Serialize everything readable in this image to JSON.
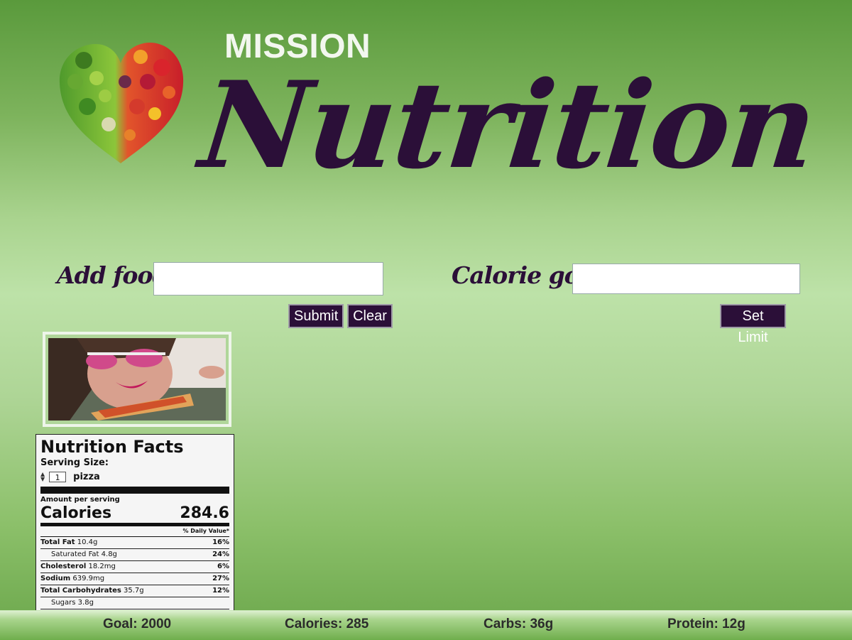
{
  "header": {
    "mission": "MISSION",
    "brand": "Nutrition"
  },
  "form": {
    "add_food_label": "Add food:",
    "food_input_value": "",
    "calorie_goal_label": "Calorie goal:",
    "goal_input_value": "",
    "submit_label": "Submit",
    "clear_label": "Clear",
    "set_limit_label": "Set Limit"
  },
  "nutrition_facts": {
    "title": "Nutrition Facts",
    "serving_size_label": "Serving Size:",
    "quantity": "1",
    "unit": "pizza",
    "amount_per_serving": "Amount per serving",
    "calories_label": "Calories",
    "calories_value": "284.6",
    "daily_value_header": "% Daily Value*",
    "rows": [
      {
        "name": "Total Fat",
        "amount": "10.4g",
        "dv": "16%",
        "indent": false
      },
      {
        "name": "Saturated Fat",
        "amount": "4.8g",
        "dv": "24%",
        "indent": true
      },
      {
        "name": "Cholesterol",
        "amount": "18.2mg",
        "dv": "6%",
        "indent": false
      },
      {
        "name": "Sodium",
        "amount": "639.9mg",
        "dv": "27%",
        "indent": false
      },
      {
        "name": "Total Carbohydrates",
        "amount": "35.7g",
        "dv": "12%",
        "indent": false
      },
      {
        "name": "Sugars",
        "amount": "3.8g",
        "dv": "",
        "indent": true
      }
    ]
  },
  "footer": {
    "goal": "Goal: 2000",
    "calories": "Calories: 285",
    "carbs": "Carbs: 36g",
    "protein": "Protein: 12g"
  },
  "colors": {
    "brand_dark": "#2b0f38",
    "background_green": "#7db35c"
  }
}
